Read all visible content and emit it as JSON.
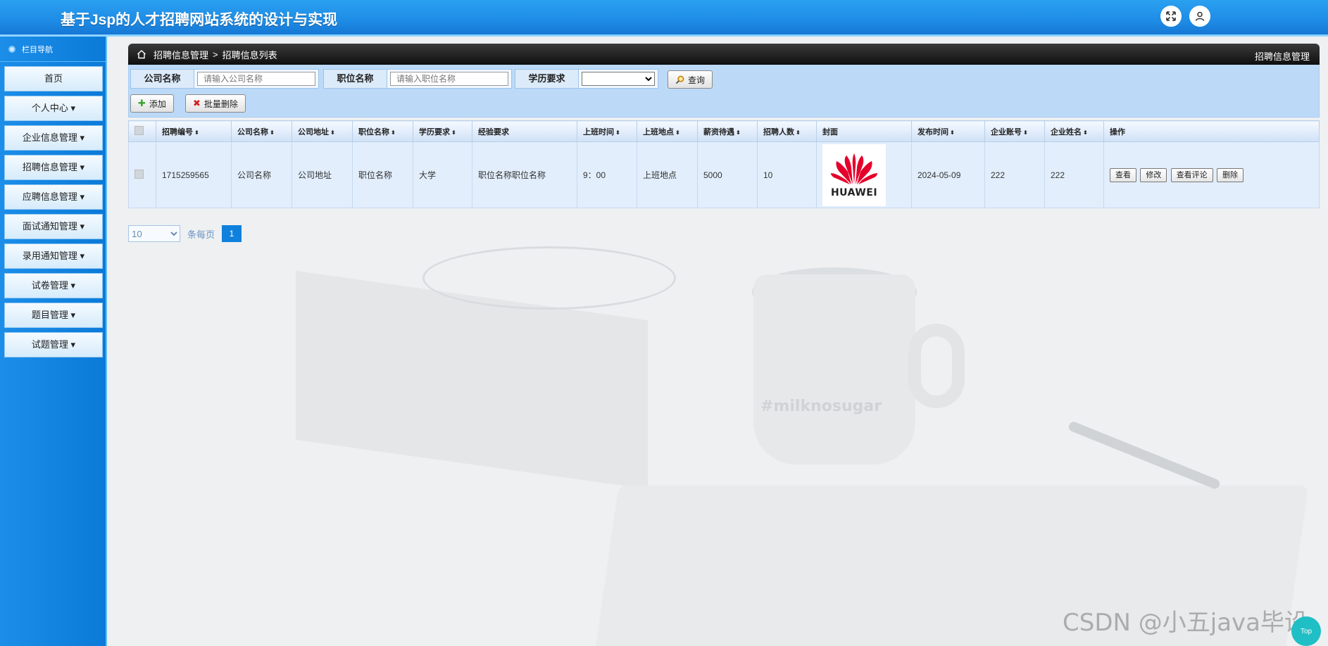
{
  "header": {
    "title": "基于Jsp的人才招聘网站系统的设计与实现",
    "fullscreen_icon": "expand-icon",
    "user_icon": "user-icon"
  },
  "sidebar": {
    "head": "栏目导航",
    "items": [
      {
        "label": "首页"
      },
      {
        "label": "个人中心 ▾"
      },
      {
        "label": "企业信息管理 ▾"
      },
      {
        "label": "招聘信息管理 ▾"
      },
      {
        "label": "应聘信息管理 ▾"
      },
      {
        "label": "面试通知管理 ▾"
      },
      {
        "label": "录用通知管理 ▾"
      },
      {
        "label": "试卷管理 ▾"
      },
      {
        "label": "题目管理 ▾"
      },
      {
        "label": "试题管理 ▾"
      }
    ]
  },
  "breadcrumb": {
    "level1": "招聘信息管理",
    "sep": ">",
    "level2": "招聘信息列表",
    "right_title": "招聘信息管理"
  },
  "search": {
    "company_label": "公司名称",
    "company_placeholder": "请输入公司名称",
    "position_label": "职位名称",
    "position_placeholder": "请输入职位名称",
    "education_label": "学历要求",
    "education_value": "",
    "query_button": "查询"
  },
  "toolbar": {
    "add_label": "添加",
    "batch_delete_label": "批量删除"
  },
  "table": {
    "headers": [
      "招聘编号",
      "公司名称",
      "公司地址",
      "职位名称",
      "学历要求",
      "经验要求",
      "上班时间",
      "上班地点",
      "薪资待遇",
      "招聘人数",
      "封面",
      "发布时间",
      "企业账号",
      "企业姓名",
      "操作"
    ],
    "rows": [
      {
        "id": "1715259565",
        "company": "公司名称",
        "address": "公司地址",
        "position": "职位名称",
        "education": "大学",
        "experience": "职位名称职位名称",
        "work_time": "9：00",
        "location": "上班地点",
        "salary": "5000",
        "count": "10",
        "cover_text": "HUAWEI",
        "publish_date": "2024-05-09",
        "account": "222",
        "name": "222",
        "actions": [
          "查看",
          "修改",
          "查看评论",
          "删除"
        ]
      }
    ]
  },
  "pager": {
    "page_size": "10",
    "per_page_label": "条每页",
    "current_page": "1"
  },
  "watermark": "CSDN @小五java毕设",
  "top_button": "Top",
  "colors": {
    "header_blue": "#1e8ce6",
    "sidebar_blue": "#0b7ad8",
    "page_active": "#0f81dd",
    "huawei_red": "#e4002b"
  }
}
